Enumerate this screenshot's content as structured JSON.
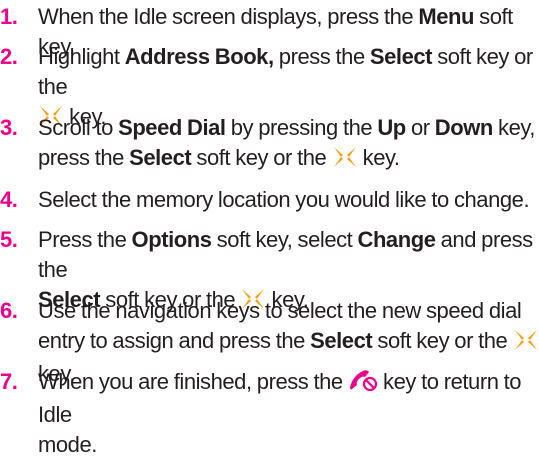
{
  "steps": [
    {
      "num": "1.",
      "parts": [
        "When the Idle screen displays, press the ",
        "Menu",
        " soft key."
      ]
    },
    {
      "num": "2.",
      "parts": [
        "Highlight ",
        "Address Book,",
        " press the ",
        "Select",
        " soft key or the",
        "key."
      ]
    },
    {
      "num": "3.",
      "parts": [
        "Scroll to ",
        "Speed Dial",
        " by pressing the ",
        "Up",
        " or ",
        "Down",
        " key,",
        "press the ",
        "Select",
        " soft key or the ",
        " key."
      ]
    },
    {
      "num": "4.",
      "parts": [
        "Select the memory location you would like to change."
      ]
    },
    {
      "num": "5.",
      "parts": [
        "Press the ",
        "Options",
        " soft key, select ",
        "Change",
        " and press the",
        "Select",
        " soft key or the ",
        " key."
      ]
    },
    {
      "num": "6.",
      "parts": [
        "Use the navigation keys to select the new speed dial",
        "entry to assign and press the ",
        "Select",
        " soft key or the ",
        "key."
      ]
    },
    {
      "num": "7.",
      "parts": [
        "When you are finished, press the ",
        " key to return to Idle",
        "mode."
      ]
    }
  ],
  "icons": {
    "ok_key": "ok-key-icon",
    "end_key": "end-call-key-icon"
  },
  "colors": {
    "step_number": "#ec008c",
    "ok_key": "#f7a21b",
    "end_key": "#ec008c",
    "text": "#231f20"
  }
}
